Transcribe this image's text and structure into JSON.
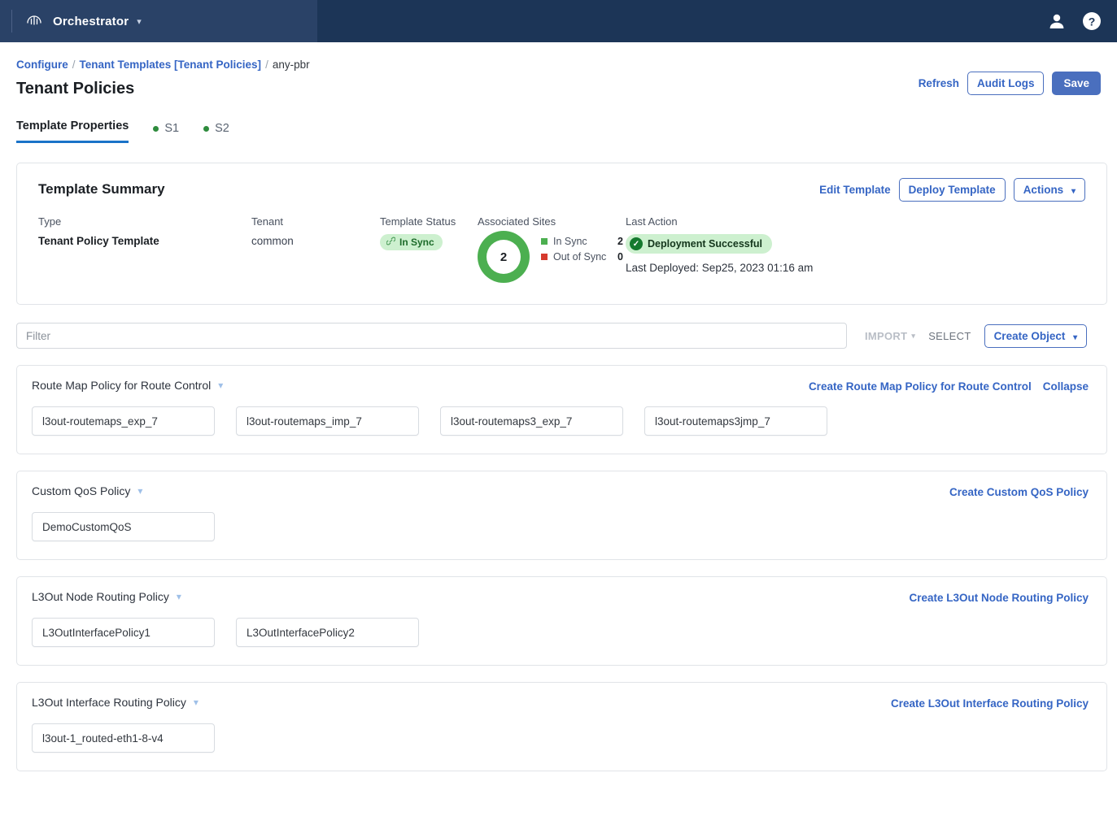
{
  "topbar": {
    "brand": "Orchestrator",
    "brand_caret": "chevron-down",
    "user_icon": "user-icon",
    "help_icon": "help-icon"
  },
  "breadcrumb": {
    "item1": "Configure",
    "item2": "Tenant Templates [Tenant Policies]",
    "current": "any-pbr",
    "sep": "/"
  },
  "page": {
    "title": "Tenant Policies",
    "refresh_label": "Refresh",
    "audit_logs_label": "Audit Logs",
    "save_label": "Save"
  },
  "tabs": [
    {
      "label": "Template Properties",
      "active": true,
      "dot": false
    },
    {
      "label": "S1",
      "active": false,
      "dot": true
    },
    {
      "label": "S2",
      "active": false,
      "dot": true
    }
  ],
  "summary": {
    "heading": "Template Summary",
    "edit_template": "Edit Template",
    "deploy_template": "Deploy Template",
    "actions": "Actions",
    "type_label": "Type",
    "type_value": "Tenant Policy Template",
    "tenant_label": "Tenant",
    "tenant_value": "common",
    "status_label": "Template Status",
    "status_value": "In Sync",
    "sites_label": "Associated Sites",
    "sites_total": "2",
    "legend": [
      {
        "name": "In Sync",
        "value": "2",
        "color": "#4caf50"
      },
      {
        "name": "Out of Sync",
        "value": "0",
        "color": "#d63a2e"
      }
    ],
    "last_action_label": "Last Action",
    "last_action_value": "Deployment Successful",
    "last_deployed": "Last Deployed: Sep25, 2023 01:16 am"
  },
  "filter": {
    "placeholder": "Filter",
    "value": "",
    "import_label": "IMPORT",
    "select_label": "SELECT",
    "create_object_label": "Create Object"
  },
  "sections": [
    {
      "title": "Route Map Policy for Route Control",
      "links": [
        "Create Route Map Policy for Route Control",
        "Collapse"
      ],
      "items": [
        "l3out-routemaps_exp_7",
        "l3out-routemaps_imp_7",
        "l3out-routemaps3_exp_7",
        "l3out-routemaps3jmp_7"
      ]
    },
    {
      "title": "Custom QoS Policy",
      "links": [
        "Create Custom QoS Policy"
      ],
      "items": [
        "DemoCustomQoS"
      ]
    },
    {
      "title": "L3Out Node Routing Policy",
      "links": [
        "Create L3Out Node Routing Policy"
      ],
      "items": [
        "L3OutInterfacePolicy1",
        "L3OutInterfacePolicy2"
      ]
    },
    {
      "title": "L3Out Interface Routing Policy",
      "links": [
        "Create L3Out Interface Routing Policy"
      ],
      "items": [
        "l3out-1_routed-eth1-8-v4"
      ]
    }
  ],
  "colors": {
    "nav_bg": "#1c3557",
    "accent_blue": "#3565c4",
    "primary_btn": "#4a6fbe",
    "green": "#4caf50",
    "red": "#d63a2e",
    "tab_underline": "#1a73c8"
  }
}
